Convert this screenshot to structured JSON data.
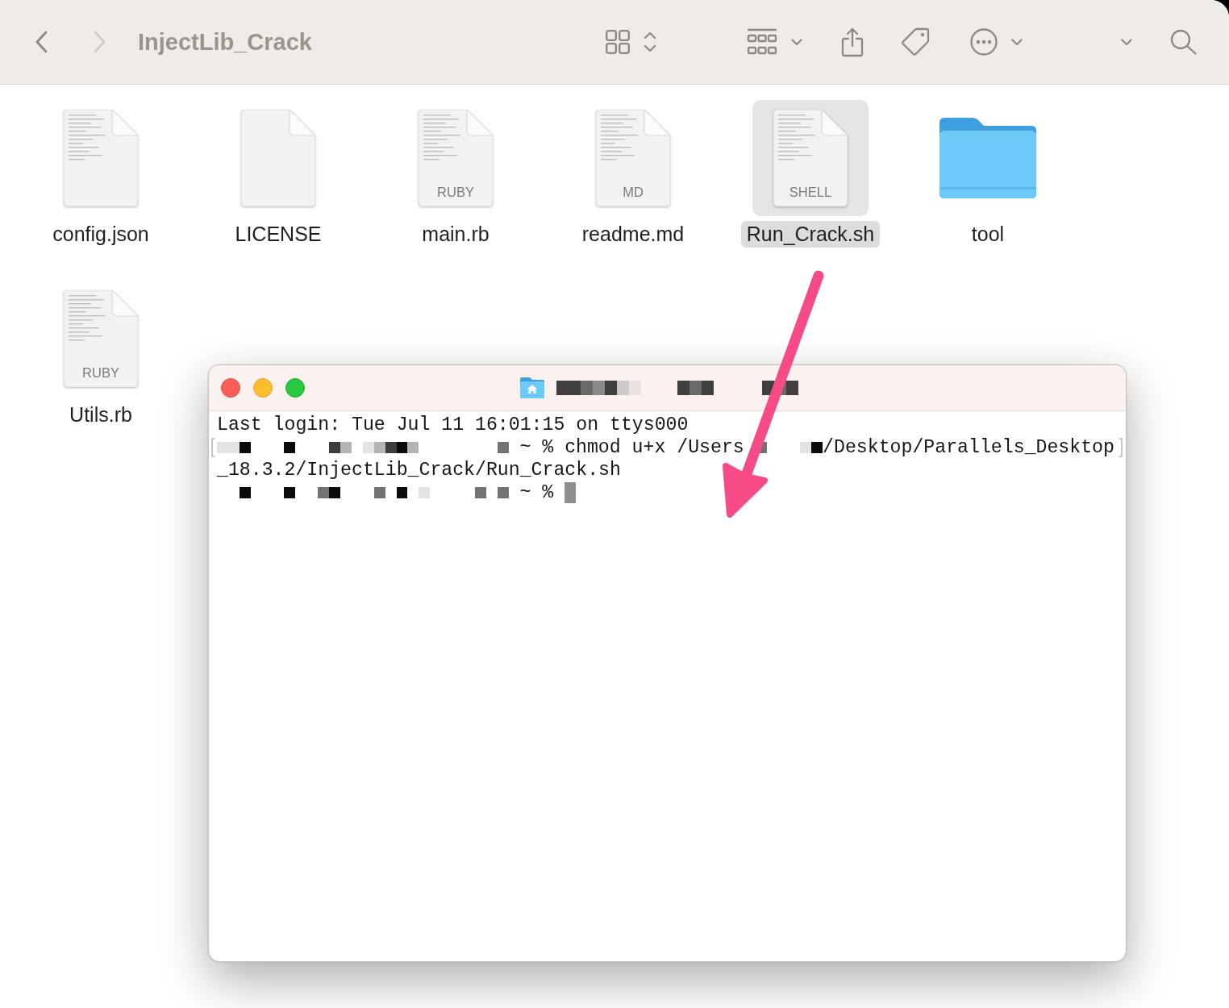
{
  "finder": {
    "toolbar": {
      "back": {
        "disabled": false
      },
      "forward": {
        "disabled": true
      },
      "title": "InjectLib_Crack"
    },
    "items": [
      {
        "name": "config.json",
        "kind": "text-document",
        "selected": false
      },
      {
        "name": "LICENSE",
        "kind": "blank-document",
        "selected": false
      },
      {
        "name": "main.rb",
        "kind": "text-document",
        "type_label": "RUBY",
        "selected": false
      },
      {
        "name": "readme.md",
        "kind": "text-document",
        "type_label": "MD",
        "selected": false
      },
      {
        "name": "Run_Crack.sh",
        "kind": "text-document",
        "type_label": "SHELL",
        "selected": true
      },
      {
        "name": "tool",
        "kind": "folder",
        "selected": false
      },
      {
        "name": "Utils.rb",
        "kind": "text-document",
        "type_label": "RUBY",
        "selected": false
      }
    ]
  },
  "terminal": {
    "lines": [
      {
        "marked": false,
        "segments": [
          {
            "kind": "text",
            "text": "Last login: Tue Jul 11 16:01:15 on ttys000"
          }
        ]
      },
      {
        "marked": true,
        "segments": [
          {
            "kind": "redacted"
          },
          {
            "kind": "text",
            "text": "~ % chmod u+x /Users"
          },
          {
            "kind": "redacted"
          },
          {
            "kind": "text",
            "text": "/Desktop/Parallels_Desktop"
          }
        ]
      },
      {
        "marked": false,
        "segments": [
          {
            "kind": "text",
            "text": "_18.3.2/InjectLib_Crack/Run_Crack.sh"
          }
        ]
      },
      {
        "marked": false,
        "segments": [
          {
            "kind": "redacted"
          },
          {
            "kind": "text",
            "text": "~ %"
          },
          {
            "kind": "cursor"
          }
        ]
      }
    ]
  }
}
